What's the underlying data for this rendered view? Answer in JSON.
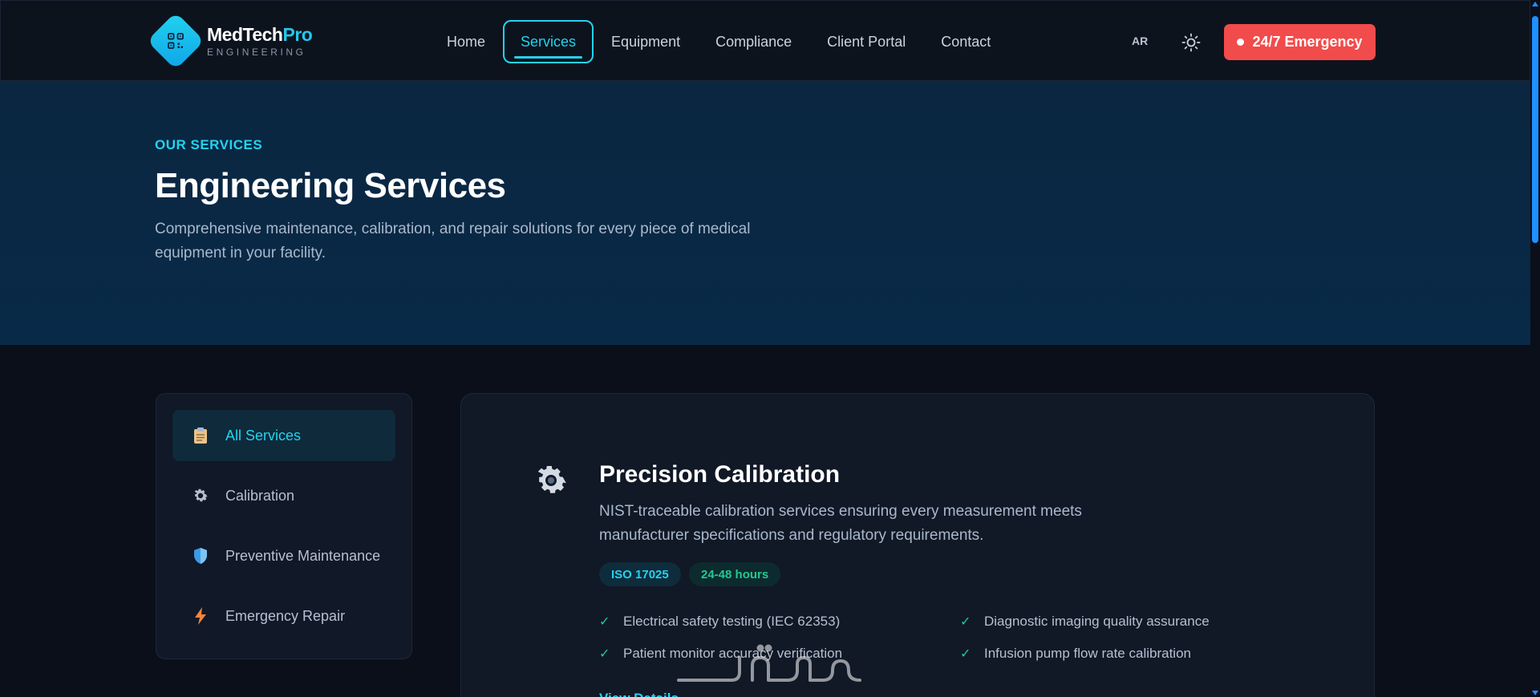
{
  "brand": {
    "name_main": "MedTech",
    "name_accent": "Pro",
    "subtitle": "ENGINEERING",
    "accent_color": "#22d3ee"
  },
  "nav": {
    "items": [
      {
        "label": "Home",
        "active": false
      },
      {
        "label": "Services",
        "active": true
      },
      {
        "label": "Equipment",
        "active": false
      },
      {
        "label": "Compliance",
        "active": false
      },
      {
        "label": "Client Portal",
        "active": false
      },
      {
        "label": "Contact",
        "active": false
      }
    ],
    "language": "AR",
    "theme_icon": "sun-icon",
    "emergency_label": "24/7 Emergency",
    "emergency_color": "#f24b4b"
  },
  "hero": {
    "eyebrow": "OUR SERVICES",
    "title": "Engineering Services",
    "description": "Comprehensive maintenance, calibration, and repair solutions for every piece of medical equipment in your facility."
  },
  "sidebar": {
    "items": [
      {
        "label": "All Services",
        "icon": "clipboard-icon",
        "active": true
      },
      {
        "label": "Calibration",
        "icon": "gear-icon",
        "active": false
      },
      {
        "label": "Preventive Maintenance",
        "icon": "shield-icon",
        "active": false
      },
      {
        "label": "Emergency Repair",
        "icon": "lightning-icon",
        "active": false
      }
    ]
  },
  "service": {
    "icon": "gear-icon",
    "title": "Precision Calibration",
    "description": "NIST-traceable calibration services ensuring every measurement meets manufacturer specifications and regulatory requirements.",
    "badges": [
      "ISO 17025",
      "24-48 hours"
    ],
    "features": [
      "Electrical safety testing (IEC 62353)",
      "Diagnostic imaging quality assurance",
      "Patient monitor accuracy verification",
      "Infusion pump flow rate calibration"
    ],
    "link": "View Details →"
  }
}
